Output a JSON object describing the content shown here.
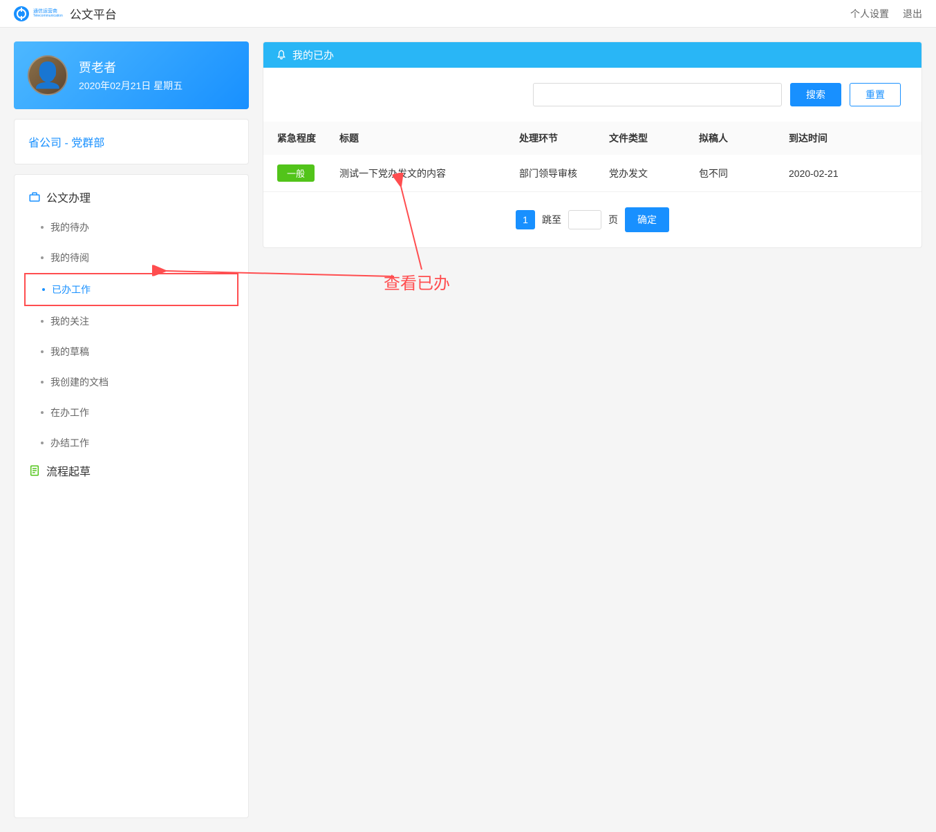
{
  "header": {
    "brand_line1": "通信运营商",
    "brand_line2": "Telecommunication",
    "app_title": "公文平台",
    "settings_label": "个人设置",
    "logout_label": "退出"
  },
  "user": {
    "name": "贾老者",
    "date": "2020年02月21日 星期五"
  },
  "org": {
    "company": "省公司",
    "separator": " - ",
    "department": "党群部"
  },
  "nav": {
    "section1_label": "公文办理",
    "items": [
      "我的待办",
      "我的待阅",
      "已办工作",
      "我的关注",
      "我的草稿",
      "我创建的文档",
      "在办工作",
      "办结工作"
    ],
    "active_index": 2,
    "section2_label": "流程起草"
  },
  "panel": {
    "title": "我的已办",
    "search_btn": "搜索",
    "reset_btn": "重置"
  },
  "table": {
    "headers": {
      "urgency": "紧急程度",
      "title": "标题",
      "stage": "处理环节",
      "type": "文件类型",
      "author": "拟稿人",
      "date": "到达时间"
    },
    "rows": [
      {
        "urgency": "一般",
        "title": "测试一下党办发文的内容",
        "stage": "部门领导审核",
        "type": "党办发文",
        "author": "包不同",
        "date": "2020-02-21"
      }
    ]
  },
  "pagination": {
    "current": "1",
    "jump_label": "跳至",
    "page_suffix": "页",
    "confirm": "确定"
  },
  "annotation": {
    "text": "查看已办"
  }
}
